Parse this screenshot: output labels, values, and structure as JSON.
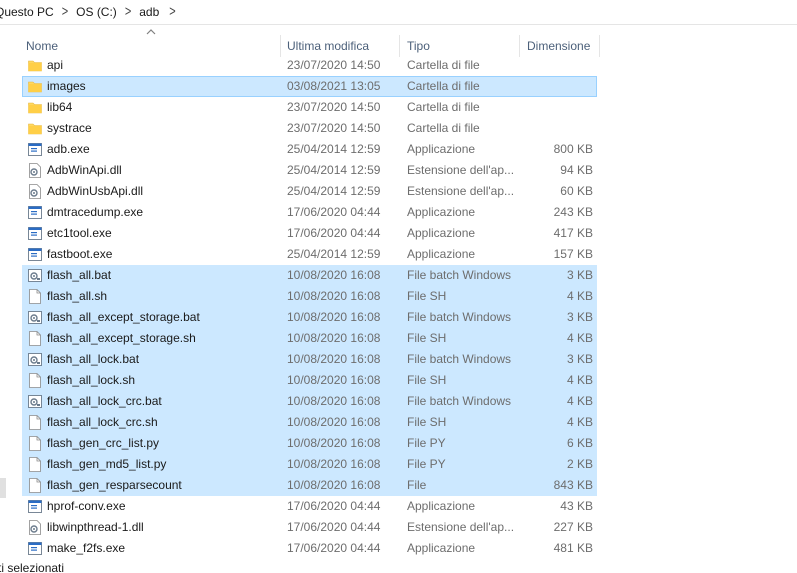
{
  "breadcrumb": [
    "Questo PC",
    "OS (C:)",
    "adb"
  ],
  "columns": {
    "name": "Nome",
    "date": "Ultima modifica",
    "type": "Tipo",
    "size": "Dimensione"
  },
  "files": [
    {
      "name": "api",
      "date": "23/07/2020 14:50",
      "type": "Cartella di file",
      "size": "",
      "icon": "folder-icon",
      "selected": false
    },
    {
      "name": "images",
      "date": "03/08/2021 13:05",
      "type": "Cartella di file",
      "size": "",
      "icon": "folder-icon",
      "selected": true,
      "focused": true
    },
    {
      "name": "lib64",
      "date": "23/07/2020 14:50",
      "type": "Cartella di file",
      "size": "",
      "icon": "folder-icon",
      "selected": false
    },
    {
      "name": "systrace",
      "date": "23/07/2020 14:50",
      "type": "Cartella di file",
      "size": "",
      "icon": "folder-icon",
      "selected": false
    },
    {
      "name": "adb.exe",
      "date": "25/04/2014 12:59",
      "type": "Applicazione",
      "size": "800 KB",
      "icon": "application-icon",
      "selected": false
    },
    {
      "name": "AdbWinApi.dll",
      "date": "25/04/2014 12:59",
      "type": "Estensione dell'ap...",
      "size": "94 KB",
      "icon": "dll-gear-icon",
      "selected": false
    },
    {
      "name": "AdbWinUsbApi.dll",
      "date": "25/04/2014 12:59",
      "type": "Estensione dell'ap...",
      "size": "60 KB",
      "icon": "dll-gear-icon",
      "selected": false
    },
    {
      "name": "dmtracedump.exe",
      "date": "17/06/2020 04:44",
      "type": "Applicazione",
      "size": "243 KB",
      "icon": "application-icon",
      "selected": false
    },
    {
      "name": "etc1tool.exe",
      "date": "17/06/2020 04:44",
      "type": "Applicazione",
      "size": "417 KB",
      "icon": "application-icon",
      "selected": false
    },
    {
      "name": "fastboot.exe",
      "date": "25/04/2014 12:59",
      "type": "Applicazione",
      "size": "157 KB",
      "icon": "application-icon",
      "selected": false
    },
    {
      "name": "flash_all.bat",
      "date": "10/08/2020 16:08",
      "type": "File batch Windows",
      "size": "3 KB",
      "icon": "batch-gear-icon",
      "selected": true
    },
    {
      "name": "flash_all.sh",
      "date": "10/08/2020 16:08",
      "type": "File SH",
      "size": "4 KB",
      "icon": "blank-file-icon",
      "selected": true
    },
    {
      "name": "flash_all_except_storage.bat",
      "date": "10/08/2020 16:08",
      "type": "File batch Windows",
      "size": "3 KB",
      "icon": "batch-gear-icon",
      "selected": true
    },
    {
      "name": "flash_all_except_storage.sh",
      "date": "10/08/2020 16:08",
      "type": "File SH",
      "size": "4 KB",
      "icon": "blank-file-icon",
      "selected": true
    },
    {
      "name": "flash_all_lock.bat",
      "date": "10/08/2020 16:08",
      "type": "File batch Windows",
      "size": "3 KB",
      "icon": "batch-gear-icon",
      "selected": true
    },
    {
      "name": "flash_all_lock.sh",
      "date": "10/08/2020 16:08",
      "type": "File SH",
      "size": "4 KB",
      "icon": "blank-file-icon",
      "selected": true
    },
    {
      "name": "flash_all_lock_crc.bat",
      "date": "10/08/2020 16:08",
      "type": "File batch Windows",
      "size": "4 KB",
      "icon": "batch-gear-icon",
      "selected": true
    },
    {
      "name": "flash_all_lock_crc.sh",
      "date": "10/08/2020 16:08",
      "type": "File SH",
      "size": "4 KB",
      "icon": "blank-file-icon",
      "selected": true
    },
    {
      "name": "flash_gen_crc_list.py",
      "date": "10/08/2020 16:08",
      "type": "File PY",
      "size": "6 KB",
      "icon": "blank-file-icon",
      "selected": true
    },
    {
      "name": "flash_gen_md5_list.py",
      "date": "10/08/2020 16:08",
      "type": "File PY",
      "size": "2 KB",
      "icon": "blank-file-icon",
      "selected": true
    },
    {
      "name": "flash_gen_resparsecount",
      "date": "10/08/2020 16:08",
      "type": "File",
      "size": "843 KB",
      "icon": "blank-file-icon",
      "selected": true
    },
    {
      "name": "hprof-conv.exe",
      "date": "17/06/2020 04:44",
      "type": "Applicazione",
      "size": "43 KB",
      "icon": "application-icon",
      "selected": false
    },
    {
      "name": "libwinpthread-1.dll",
      "date": "17/06/2020 04:44",
      "type": "Estensione dell'ap...",
      "size": "227 KB",
      "icon": "dll-gear-icon",
      "selected": false
    },
    {
      "name": "make_f2fs.exe",
      "date": "17/06/2020 04:44",
      "type": "Applicazione",
      "size": "481 KB",
      "icon": "application-icon",
      "selected": false
    }
  ],
  "status": {
    "text": "ti selezionati"
  },
  "colors": {
    "selection": "#cce8ff",
    "focus_border": "#99d1ff",
    "header_text": "#4c607a",
    "folder": "#ffd75e"
  }
}
